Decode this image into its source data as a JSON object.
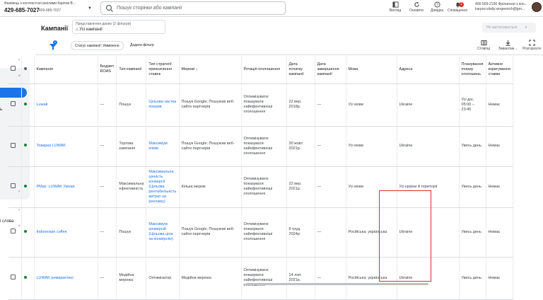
{
  "topbar": {
    "account_name": "Фахівець з контекстної реклами Карпов В...",
    "account_id": "429-685-7027",
    "account_sub_id": "429-685-7027",
    "search_placeholder": "Пошук сторінки або кампанії",
    "buttons": [
      {
        "label": "Вигляд",
        "icon": "appearance-icon"
      },
      {
        "label": "Оновити",
        "icon": "refresh-icon"
      },
      {
        "label": "Довідка",
        "icon": "help-icon"
      },
      {
        "label": "Сповіщення",
        "icon": "bell-icon",
        "badge": "1"
      }
    ],
    "user_line1": "400-509-2156 Фрілансер з кон...",
    "user_line2": "karpov.vitaliy.sergeevich@gm..."
  },
  "sidebar": {
    "items": [
      {
        "label": "",
        "chevron": "›"
      },
      {
        "label": "",
        "chevron": "^"
      },
      {
        "label": "ь",
        "chevron": ""
      },
      {
        "label": "",
        "chevron": "›"
      },
      {
        "label": "",
        "chevron": "›"
      },
      {
        "label": "і слова",
        "chevron": "^"
      }
    ]
  },
  "header": {
    "title": "Кампанії",
    "view_label": "Представлення даних (2 фільтри)",
    "view_value": "Усі кампанії",
    "apply_label": "Не застосовується"
  },
  "filters": {
    "badge": "1",
    "chip": "Статус кампанії: Увімкнено",
    "add_filter": "Додати фільтр"
  },
  "toolbar_right": [
    {
      "label": "Стовпці",
      "icon": "columns-icon"
    },
    {
      "label": "Завантаж...",
      "icon": "download-icon"
    },
    {
      "label": "Розгорнути",
      "icon": "expand-icon"
    }
  ],
  "columns": [
    "",
    "",
    "Кампанія",
    "Бюджет ROAS",
    "Тип кампанії",
    "Тип стратегії призначення ставок",
    "Мережі ↓",
    "Ротація оголошення",
    "Дата початку кампанії",
    "Дата завершення кампанії",
    "Мова",
    "Адреса",
    "Планування показу оголошень",
    "Активне коригування ставки"
  ],
  "rows": [
    {
      "campaign": "Luwak",
      "budget": "—",
      "type": "Пошук",
      "strategy": "Цільова частка показів",
      "networks": "Пошук Google; Пошукові веб-сайти партнерів",
      "rotation": "Оптимізувати: показувати найефективніші оголошення",
      "start": "22 вер. 2018р.",
      "end": "—",
      "language": "Усі мови",
      "location": "Ukraine",
      "schedule": "Усі дні, 05:00 – 23:45",
      "bid_adj": "Немає"
    },
    {
      "campaign": "Товарка LUWAK",
      "budget": "—",
      "type": "Торгова кампанія",
      "strategy": "Максимум кліків",
      "networks": "Пошук Google; Пошукові веб-сайти партнерів",
      "rotation": "Оптимізувати: показувати найефективніші оголошення",
      "start": "30 жовт. 2021р.",
      "end": "—",
      "language": "Усі мови",
      "location": "Ukraine",
      "schedule": "Увесь день",
      "bid_adj": "Немає"
    },
    {
      "campaign": "PMax: LUWAK Умная",
      "budget": "—",
      "type": "Максимальна ефективність",
      "strategy": "Максимальна цінність конверсії (Цільова рентабельність витрат на рекламу)",
      "networks": "Кілька мереж",
      "rotation": "Оптимізувати: показувати найефективніші оголошення",
      "start": "22 вер. 2021р.",
      "end": "—",
      "language": "Усі мови",
      "location": "Усі країни й території",
      "schedule": "Увесь день",
      "bid_adj": "Немає"
    },
    {
      "campaign": "Indonesian coffee",
      "budget": "—",
      "type": "Пошук",
      "strategy": "Максимум конверсій (Цільова ціна за конверсію)",
      "networks": "Пошук Google; Пошукові веб-сайти партнерів",
      "rotation": "Оптимізувати: показувати найефективніші оголошення",
      "start": "8 груд. 2024р.",
      "end": "—",
      "language": "Російська; українська",
      "location": "Ukraine",
      "schedule": "Увесь день",
      "bid_adj": "Немає"
    },
    {
      "campaign": "LUWAK ремаркетинг",
      "budget": "—",
      "type": "Медійна мережа",
      "strategy": "Оптимізатор",
      "networks": "Медійна мережа",
      "rotation": "Оптимізувати: показувати найефективніші оголошення",
      "start": "14 лют. 2021р.",
      "end": "—",
      "language": "Російська; українська",
      "location": "Ukraine",
      "schedule": "Увесь день",
      "bid_adj": "Немає"
    }
  ],
  "colors": {
    "accent": "#1a73e8",
    "status_enabled": "#188038",
    "highlight": "#d93025"
  }
}
